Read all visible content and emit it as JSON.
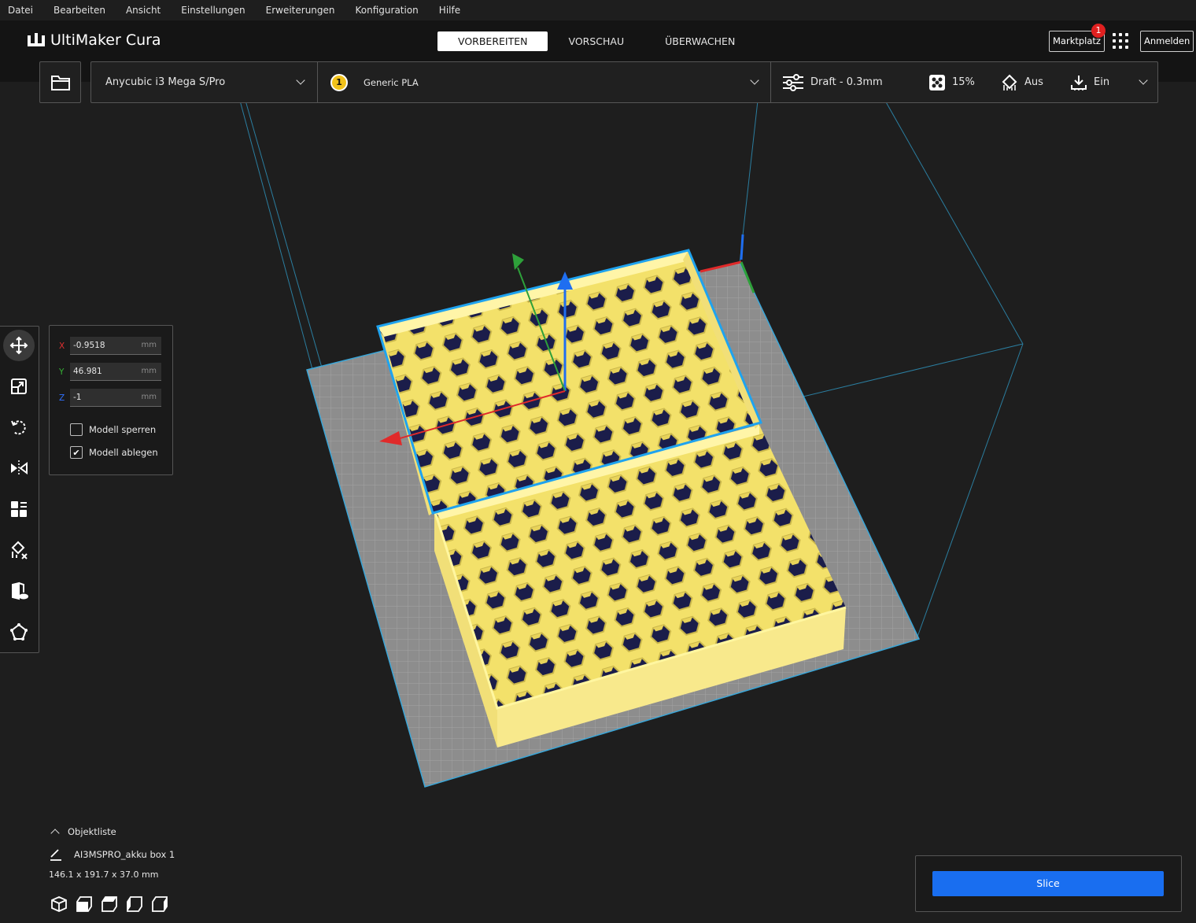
{
  "menu": [
    "Datei",
    "Bearbeiten",
    "Ansicht",
    "Einstellungen",
    "Erweiterungen",
    "Konfiguration",
    "Hilfe"
  ],
  "app": {
    "logo_text": "UltiMaker Cura"
  },
  "stages": [
    {
      "label": "VORBEREITEN",
      "active": true
    },
    {
      "label": "VORSCHAU",
      "active": false
    },
    {
      "label": "ÜBERWACHEN",
      "active": false
    }
  ],
  "header_right": {
    "marketplace": "Marktplatz",
    "marketplace_badge": "1",
    "signin": "Anmelden"
  },
  "printer": {
    "name": "Anycubic i3 Mega S/Pro"
  },
  "material": {
    "extruder": "1",
    "name": "Generic PLA"
  },
  "print_settings": {
    "profile": "Draft - 0.3mm",
    "infill": "15%",
    "support": "Aus",
    "adhesion": "Ein"
  },
  "move_tool": {
    "x": {
      "label": "X",
      "value": "-0.9518",
      "unit": "mm",
      "color": "#e03030"
    },
    "y": {
      "label": "Y",
      "value": "46.981",
      "unit": "mm",
      "color": "#35b035"
    },
    "z": {
      "label": "Z",
      "value": "-1",
      "unit": "mm",
      "color": "#3070ff"
    },
    "lock_model": {
      "label": "Modell sperren",
      "checked": false
    },
    "drop_model": {
      "label": "Modell ablegen",
      "checked": true
    }
  },
  "tools": [
    "move-icon",
    "scale-icon",
    "rotate-icon",
    "mirror-icon",
    "per-model-settings-icon",
    "support-blocker-icon",
    "mesh-type-icon",
    "custom-shape-icon"
  ],
  "object_list": {
    "title": "Objektliste",
    "item": "AI3MSPRO_akku box 1",
    "dimensions": "146.1 x 191.7 x 37.0 mm"
  },
  "view_buttons": [
    "3d-view-icon",
    "front-view-icon",
    "top-view-icon",
    "left-view-icon",
    "right-view-icon"
  ],
  "slice": {
    "label": "Slice"
  },
  "colors": {
    "accent": "#196ef0",
    "model": "#f7ec7a",
    "selection": "#1fa3ef",
    "badge": "#e02020"
  }
}
